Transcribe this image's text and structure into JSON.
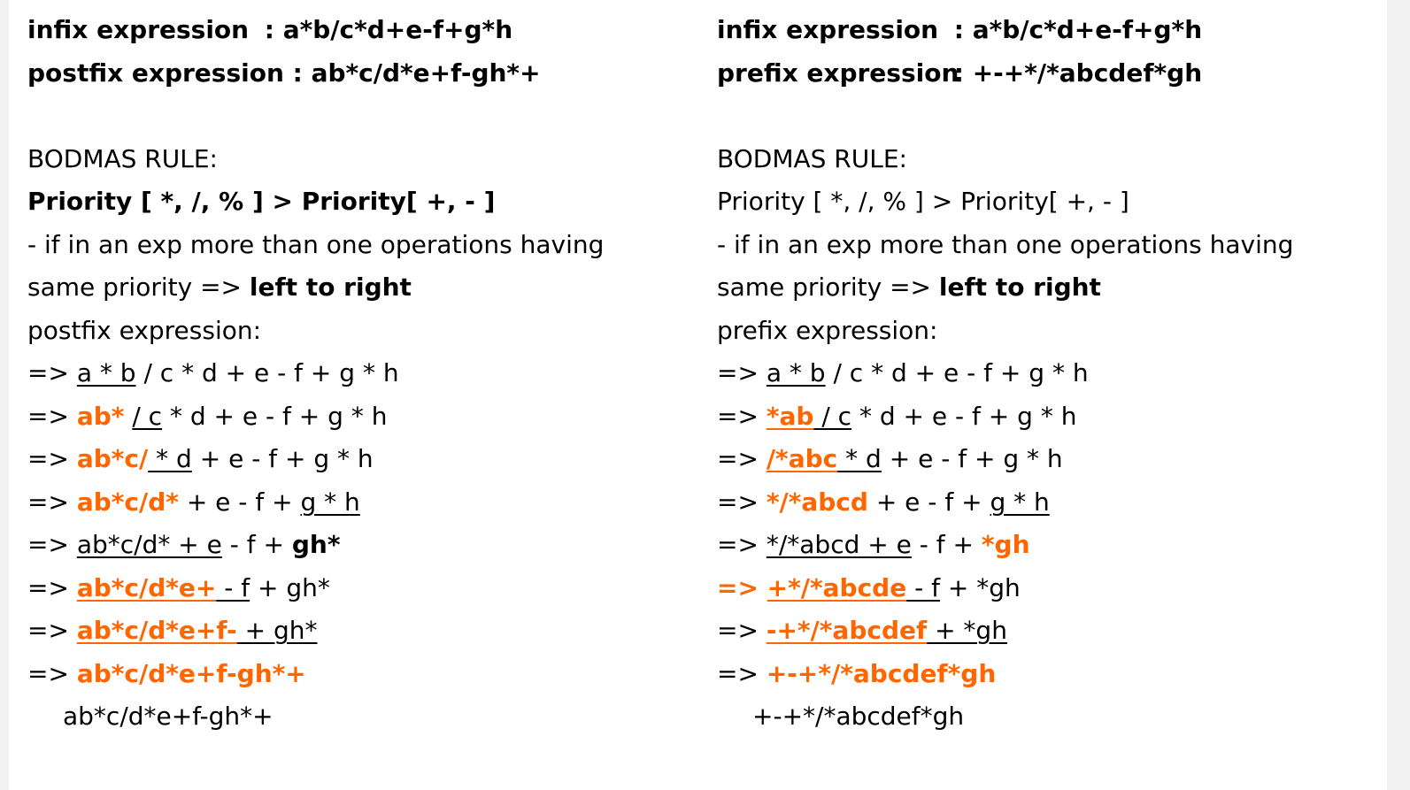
{
  "left": {
    "header": [
      {
        "label": "infix expression",
        "sep": " : ",
        "value": "a*b/c*d+e-f+g*h"
      },
      {
        "label": "postfix expression",
        "sep": " : ",
        "value": "ab*c/d*e+f-gh*+"
      }
    ],
    "bodmas_title": "BODMAS RULE:",
    "priority_rule": "Priority [ *, /, % ] > Priority[ +, - ]",
    "rule_line1": "- if in an exp more than one operations having",
    "rule_line2_prefix": "same priority => ",
    "rule_line2_bold": "left to right",
    "expr_title": "postfix expression:",
    "steps": [
      [
        {
          "t": "=> "
        },
        {
          "t": "a * b",
          "u": true
        },
        {
          "t": " / c * d + e - f + g * h"
        }
      ],
      [
        {
          "t": "=> "
        },
        {
          "t": "ab*",
          "o": true
        },
        {
          "t": " ",
          "u": false
        },
        {
          "t": "/ c",
          "u": true
        },
        {
          "t": " * d + e - f + g * h"
        }
      ],
      [
        {
          "t": "=> "
        },
        {
          "t": "ab*c/",
          "o": true
        },
        {
          "t": " * d",
          "u": true
        },
        {
          "t": " + e - f + g * h"
        }
      ],
      [
        {
          "t": "=> "
        },
        {
          "t": "ab*c/d*",
          "o": true
        },
        {
          "t": " + e - f + "
        },
        {
          "t": "g * h",
          "u": true
        }
      ],
      [
        {
          "t": "=> "
        },
        {
          "t": "ab*c/d* + e",
          "u": true
        },
        {
          "t": " - f + "
        },
        {
          "t": "gh*",
          "b": true
        }
      ],
      [
        {
          "t": "=> "
        },
        {
          "t": "ab*c/d*e+",
          "o": true,
          "u": true
        },
        {
          "t": " - f",
          "u": true
        },
        {
          "t": " + gh*"
        }
      ],
      [
        {
          "t": "=> "
        },
        {
          "t": "ab*c/d*e+f-",
          "o": true,
          "u": true
        },
        {
          "t": " + gh*",
          "u": true
        }
      ],
      [
        {
          "t": "=> "
        },
        {
          "t": "ab*c/d*e+f-gh*+",
          "o": true
        }
      ]
    ],
    "result": "ab*c/d*e+f-gh*+"
  },
  "right": {
    "header": [
      {
        "label": "infix expression",
        "sep": " : ",
        "value": "a*b/c*d+e-f+g*h"
      },
      {
        "label": "prefix expression",
        "sep": " : ",
        "value": "+-+*/*abcdef*gh"
      }
    ],
    "bodmas_title": "BODMAS RULE:",
    "priority_rule": "Priority [ *, /, % ] > Priority[ +, - ]",
    "rule_line1": "- if in an exp more than one operations having",
    "rule_line2_prefix": "same priority => ",
    "rule_line2_bold": "left to right",
    "expr_title": "prefix expression:",
    "steps": [
      [
        {
          "t": "=> "
        },
        {
          "t": "a * b",
          "u": true
        },
        {
          "t": " / c * d + e - f + g * h"
        }
      ],
      [
        {
          "t": "=> "
        },
        {
          "t": "*ab",
          "o": true,
          "u": true
        },
        {
          "t": " / c",
          "u": true
        },
        {
          "t": " * d + e - f + g * h"
        }
      ],
      [
        {
          "t": "=> "
        },
        {
          "t": "/*abc",
          "o": true,
          "u": true
        },
        {
          "t": " * d",
          "u": true
        },
        {
          "t": " + e - f + g * h"
        }
      ],
      [
        {
          "t": "=> "
        },
        {
          "t": "*/*abcd",
          "o": true
        },
        {
          "t": " + e - f + "
        },
        {
          "t": "g * h",
          "u": true
        }
      ],
      [
        {
          "t": "=> "
        },
        {
          "t": "*/*abcd + e",
          "u": true
        },
        {
          "t": " - f + "
        },
        {
          "t": "*gh",
          "o": true
        }
      ],
      [
        {
          "t": "=> ",
          "o": true
        },
        {
          "t": "+*/*abcde",
          "o": true,
          "u": true
        },
        {
          "t": " - f",
          "u": true
        },
        {
          "t": " + *gh"
        }
      ],
      [
        {
          "t": "=> "
        },
        {
          "t": "-+*/*abcdef",
          "o": true,
          "u": true
        },
        {
          "t": " + *gh",
          "u": true
        }
      ],
      [
        {
          "t": "=> "
        },
        {
          "t": "+-+*/*abcdef*gh",
          "o": true
        }
      ]
    ],
    "result": "+-+*/*abcdef*gh"
  }
}
